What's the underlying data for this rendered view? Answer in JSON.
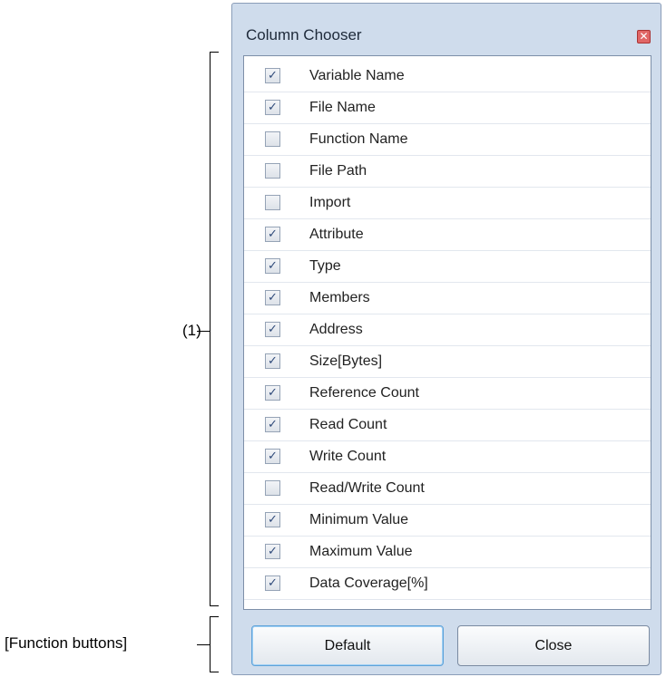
{
  "annotations": {
    "list_label": "(1)",
    "buttons_label": "[Function buttons]"
  },
  "dialog": {
    "title": "Column Chooser",
    "close_icon": "close-icon",
    "columns": [
      {
        "label": "Variable Name",
        "checked": true
      },
      {
        "label": "File Name",
        "checked": true
      },
      {
        "label": "Function Name",
        "checked": false
      },
      {
        "label": "File Path",
        "checked": false
      },
      {
        "label": "Import",
        "checked": false
      },
      {
        "label": "Attribute",
        "checked": true
      },
      {
        "label": "Type",
        "checked": true
      },
      {
        "label": "Members",
        "checked": true
      },
      {
        "label": "Address",
        "checked": true
      },
      {
        "label": "Size[Bytes]",
        "checked": true
      },
      {
        "label": "Reference Count",
        "checked": true
      },
      {
        "label": "Read Count",
        "checked": true
      },
      {
        "label": "Write Count",
        "checked": true
      },
      {
        "label": "Read/Write Count",
        "checked": false
      },
      {
        "label": "Minimum Value",
        "checked": true
      },
      {
        "label": "Maximum Value",
        "checked": true
      },
      {
        "label": "Data Coverage[%]",
        "checked": true
      }
    ],
    "buttons": {
      "default_label": "Default",
      "close_label": "Close"
    }
  }
}
